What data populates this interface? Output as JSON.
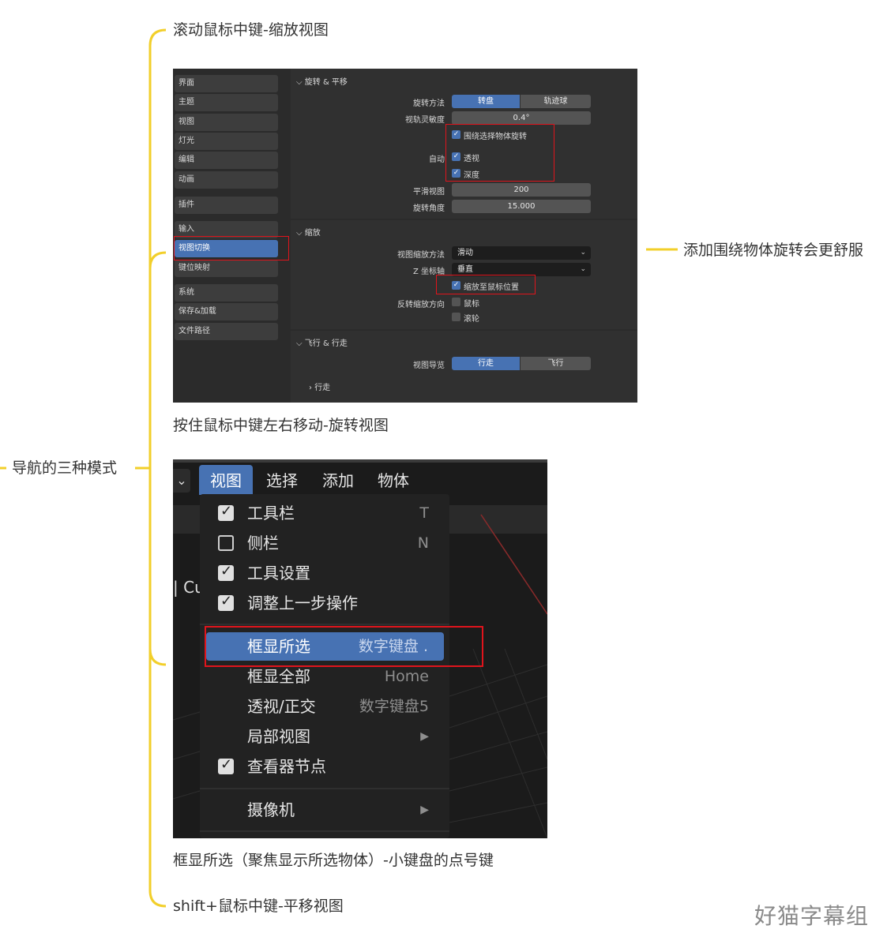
{
  "mindmap": {
    "root": "导航的三种模式",
    "branch_zoom": "滚动鼠标中键-缩放视图",
    "branch_rotate": "按住鼠标中键左右移动-旋转视图",
    "branch_frame": "框显所选（聚焦显示所选物体）-小键盘的点号键",
    "branch_pan": "shift+鼠标中键-平移视图",
    "annotation": "添加围绕物体旋转会更舒服"
  },
  "prefs": {
    "sidebar": [
      "界面",
      "主题",
      "视图",
      "灯光",
      "编辑",
      "动画",
      "插件",
      "输入",
      "视图切换",
      "键位映射",
      "系统",
      "保存&加载",
      "文件路径"
    ],
    "rotate_section": {
      "title": "旋转 & 平移",
      "method_label": "旋转方法",
      "method_on": "转盘",
      "method_off": "轨迹球",
      "sensitivity_label": "视轨灵敏度",
      "sensitivity_value": "0.4°",
      "orbit_selection": "围绕选择物体旋转",
      "auto_label": "自动",
      "auto_perspective": "透视",
      "auto_depth": "深度",
      "smooth_label": "平滑视图",
      "smooth_value": "200",
      "angle_label": "旋转角度",
      "angle_value": "15.000"
    },
    "zoom_section": {
      "title": "缩放",
      "zoom_method_label": "视图缩放方法",
      "zoom_method_value": "滑动",
      "z_axis_label": "Z 坐标轴",
      "z_axis_value": "垂直",
      "zoom_to_mouse": "缩放至鼠标位置",
      "invert_label": "反转缩放方向",
      "invert_mouse": "鼠标",
      "invert_wheel": "滚轮"
    },
    "fly_section": {
      "title": "飞行 & 行走",
      "nav_label": "视图导览",
      "nav_on": "行走",
      "nav_off": "飞行",
      "walk_sub": "行走"
    }
  },
  "view_menu": {
    "menubar": [
      "视图",
      "选择",
      "添加",
      "物体"
    ],
    "partial_text": "Cu",
    "items": [
      {
        "label": "工具栏",
        "key": "T",
        "check": "on"
      },
      {
        "label": "侧栏",
        "key": "N",
        "check": "off"
      },
      {
        "label": "工具设置",
        "key": "",
        "check": "on"
      },
      {
        "label": "调整上一步操作",
        "key": "",
        "check": "on"
      },
      {
        "label": "框显所选",
        "key": "数字键盘 .",
        "check": "none"
      },
      {
        "label": "框显全部",
        "key": "Home",
        "check": "none"
      },
      {
        "label": "透视/正交",
        "key": "数字键盘5",
        "check": "none"
      },
      {
        "label": "局部视图",
        "key": "▶",
        "check": "none"
      },
      {
        "label": "查看器节点",
        "key": "",
        "check": "on"
      },
      {
        "label": "摄像机",
        "key": "▶",
        "check": "none"
      }
    ]
  },
  "watermark": "好猫字幕组",
  "colors": {
    "branch_line": "#f2cf2a",
    "highlight": "#e0141c",
    "blender_blue": "#4772b3"
  }
}
